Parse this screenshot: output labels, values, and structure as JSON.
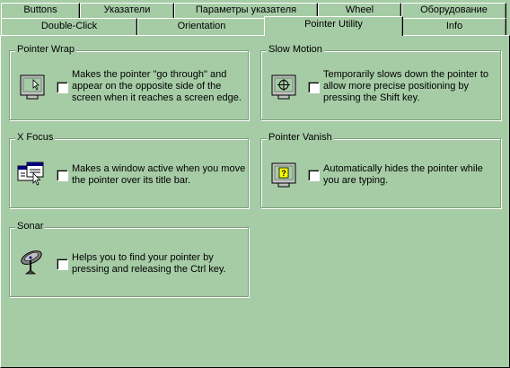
{
  "tabs_row1": [
    "Buttons",
    "Указатели",
    "Параметры указателя",
    "Wheel",
    "Оборудование"
  ],
  "tabs_row2": [
    "Double-Click",
    "Orientation",
    "Pointer Utility",
    "Info"
  ],
  "active_tab": "Pointer Utility",
  "groups": {
    "pointer_wrap": {
      "title": "Pointer Wrap",
      "icon": "pointer-wrap-icon",
      "checked": false,
      "description": "Makes the pointer \"go through\" and appear on the opposite side of the screen when it reaches a screen edge."
    },
    "slow_motion": {
      "title": "Slow Motion",
      "icon": "slow-motion-icon",
      "checked": false,
      "description": "Temporarily slows down the pointer to allow more precise positioning by pressing the Shift key."
    },
    "x_focus": {
      "title": "X Focus",
      "icon": "x-focus-icon",
      "checked": false,
      "description": "Makes a window active when you move the pointer over its title bar."
    },
    "pointer_vanish": {
      "title": "Pointer Vanish",
      "icon": "pointer-vanish-icon",
      "checked": false,
      "description": "Automatically hides the pointer while you are typing."
    },
    "sonar": {
      "title": "Sonar",
      "icon": "sonar-icon",
      "checked": false,
      "description": "Helps you to find your pointer by pressing and releasing the Ctrl key."
    }
  },
  "colors": {
    "background": "#a6cca6",
    "highlight": "#ffffff",
    "shadow": "#7d9c7d"
  }
}
